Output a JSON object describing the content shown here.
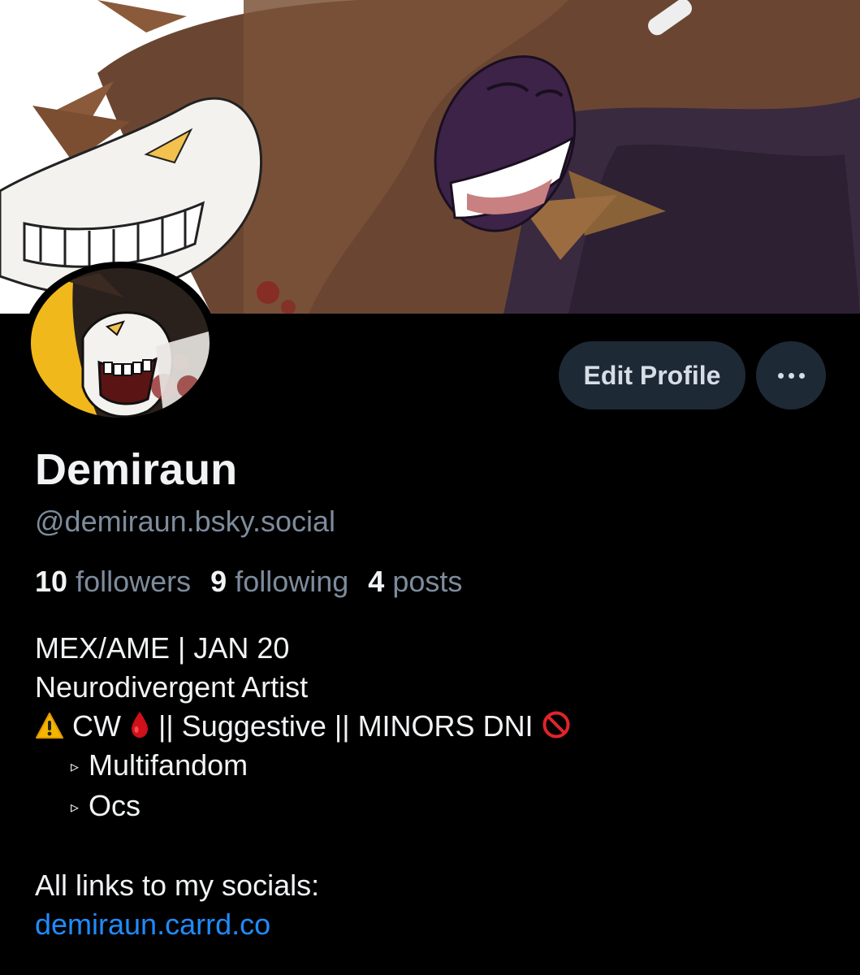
{
  "profile": {
    "display_name": "Demiraun",
    "handle": "@demiraun.bsky.social",
    "stats": {
      "followers_count": "10",
      "followers_label": "followers",
      "following_count": "9",
      "following_label": "following",
      "posts_count": "4",
      "posts_label": "posts"
    },
    "bio": {
      "line1": "MEX/AME | JAN 20",
      "line2": "Neurodivergent Artist",
      "line3_a": "CW",
      "line3_b": "|| Suggestive || MINORS DNI",
      "item1": "Multifandom",
      "item2": "Ocs",
      "socials_label": "All links to my socials:",
      "link": "demiraun.carrd.co"
    }
  },
  "actions": {
    "edit_profile_label": "Edit Profile",
    "more_icon": "ellipsis-icon"
  },
  "icons": {
    "warning": "warning-icon",
    "blood_drop": "blood-drop-icon",
    "prohibited": "prohibited-icon",
    "bullet": "triangle-bullet-icon"
  },
  "colors": {
    "background": "#000000",
    "button_bg": "#1e2936",
    "muted_text": "#7d8c9c",
    "link": "#208bfe"
  }
}
